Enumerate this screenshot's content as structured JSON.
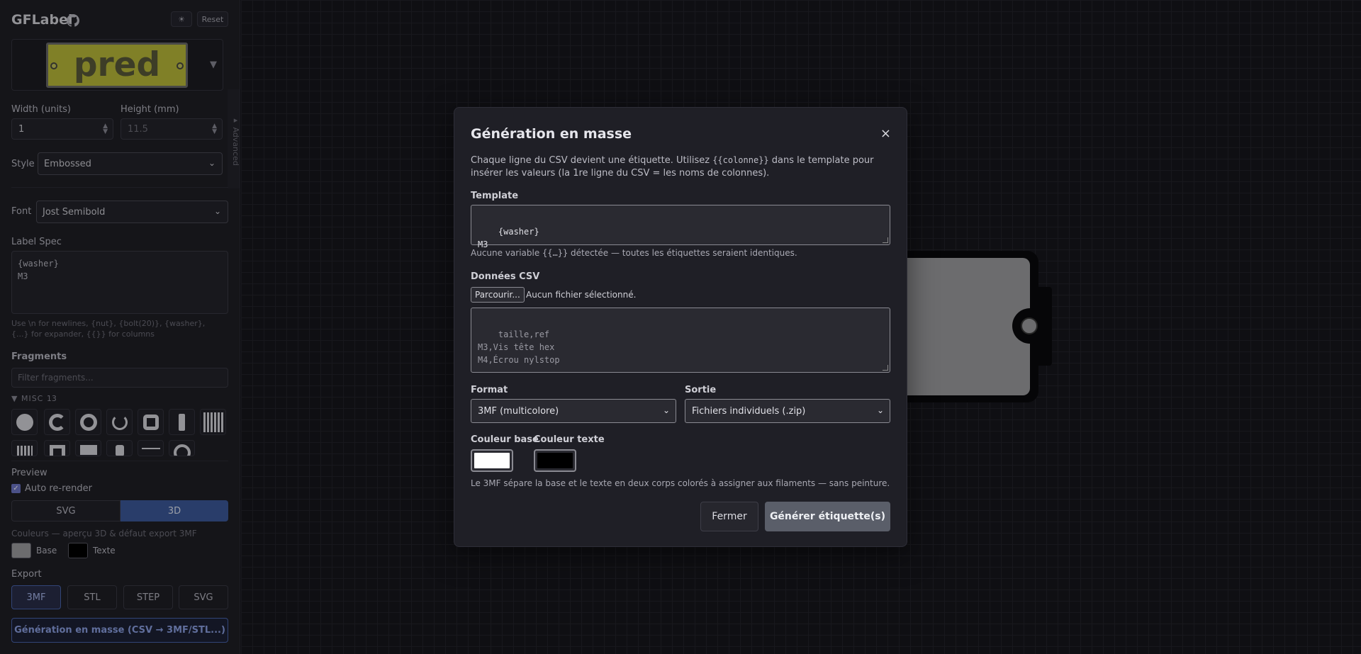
{
  "app": {
    "title": "GFLabel",
    "theme_toggle": "☀",
    "reset_label": "Reset",
    "label_preview_text": "pred",
    "advanced_tab": "▸ Advanced"
  },
  "sidebar": {
    "width_label": "Width (units)",
    "width_value": "1",
    "height_label": "Height (mm)",
    "height_value": "11.5",
    "style_label": "Style",
    "style_value": "Embossed",
    "font_label": "Font",
    "font_value": "Jost Semibold",
    "label_spec_label": "Label Spec",
    "label_spec_value": "{washer}\nM3",
    "label_spec_help": "Use \\n for newlines, {nut}, {bolt(20)}, {washer}, {...} for expander, {{}} for columns",
    "fragments_title": "Fragments",
    "fragments_placeholder": "Filter fragments...",
    "group_name": "MISC",
    "group_count": "13",
    "preview_title": "Preview",
    "auto_rerender": "Auto re-render",
    "svg_tab": "SVG",
    "tab_3d": "3D",
    "colors_help": "Couleurs — aperçu 3D & défaut export 3MF",
    "base_label": "Base",
    "text_label": "Texte",
    "base_color": "#a0a0a2",
    "text_color": "#000000",
    "export_title": "Export",
    "export_buttons": [
      "3MF",
      "STL",
      "STEP",
      "SVG"
    ],
    "mass_button": "Génération en masse (CSV → 3MF/STL...)"
  },
  "modal": {
    "title": "Génération en masse",
    "close": "×",
    "desc_1": "Chaque ligne du CSV devient une étiquette. Utilisez ",
    "desc_code": "{{colonne}}",
    "desc_2": " dans le template pour insérer les valeurs (la 1re ligne du CSV = les noms de colonnes).",
    "template_label": "Template",
    "template_value": "{washer}\nM3",
    "warn_1": "Aucune variable ",
    "warn_code": "{{…}}",
    "warn_2": " détectée — toutes les étiquettes seraient identiques.",
    "csv_label": "Données CSV",
    "browse_button": "Parcourir...",
    "file_status": "Aucun fichier sélectionné.",
    "csv_placeholder": "taille,ref\nM3,Vis tête hex\nM4,Écrou nylstop",
    "format_label": "Format",
    "format_value": "3MF (multicolore)",
    "output_label": "Sortie",
    "output_value": "Fichiers individuels (.zip)",
    "base_color_label": "Couleur base",
    "text_color_label": "Couleur texte",
    "base_color": "#ffffff",
    "text_color": "#000000",
    "note": "Le 3MF sépare la base et le texte en deux corps colorés à assigner aux filaments — sans peinture.",
    "close_button": "Fermer",
    "generate_button": "Générer étiquette(s)"
  }
}
